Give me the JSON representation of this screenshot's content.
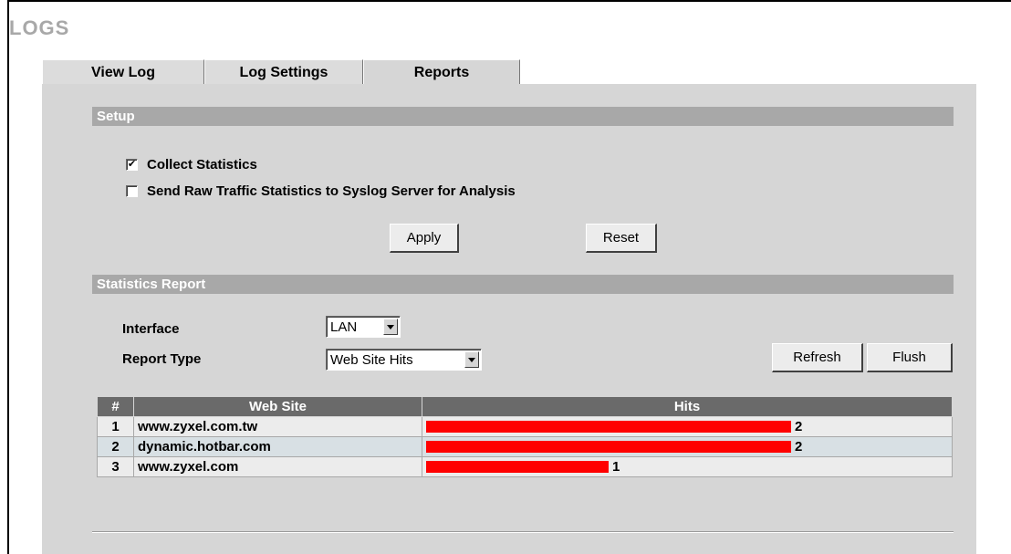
{
  "page": {
    "title": "LOGS"
  },
  "tabs": [
    {
      "label": "View Log",
      "active": false
    },
    {
      "label": "Log Settings",
      "active": false
    },
    {
      "label": "Reports",
      "active": true
    }
  ],
  "setup": {
    "heading": "Setup",
    "collect_statistics": {
      "label": "Collect Statistics",
      "checked": true
    },
    "send_raw": {
      "label": "Send Raw Traffic Statistics to Syslog Server for Analysis",
      "checked": false
    },
    "apply_label": "Apply",
    "reset_label": "Reset"
  },
  "report": {
    "heading": "Statistics Report",
    "interface_label": "Interface",
    "interface_value": "LAN",
    "report_type_label": "Report Type",
    "report_type_value": "Web Site Hits",
    "refresh_label": "Refresh",
    "flush_label": "Flush",
    "columns": [
      "#",
      "Web Site",
      "Hits"
    ],
    "rows": [
      {
        "num": "1",
        "site": "www.zyxel.com.tw",
        "hits": "2"
      },
      {
        "num": "2",
        "site": "dynamic.hotbar.com",
        "hits": "2"
      },
      {
        "num": "3",
        "site": "www.zyxel.com",
        "hits": "1"
      }
    ]
  },
  "colors": {
    "bar": "#ff0000",
    "section_header": "#a8a8a8",
    "table_header": "#6a6a6a",
    "panel": "#d6d6d6"
  }
}
